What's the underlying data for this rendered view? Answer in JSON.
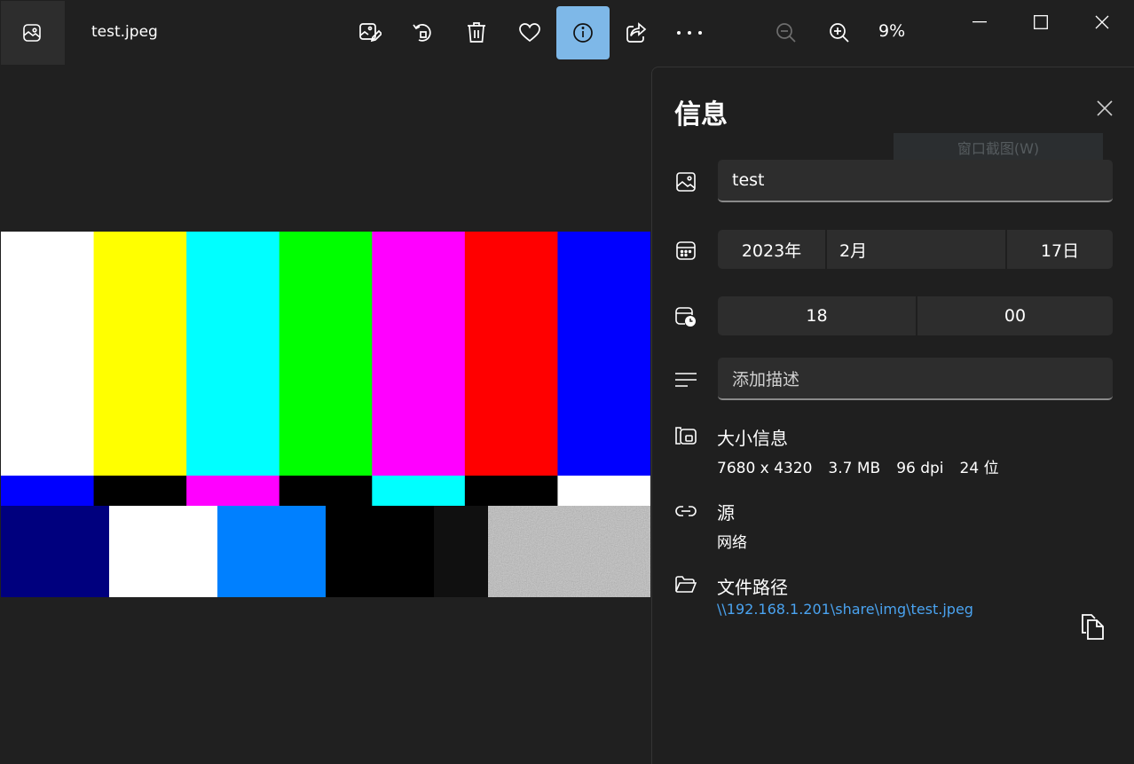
{
  "titlebar": {
    "filename": "test.jpeg",
    "zoom": "9%",
    "toolbar_icons": [
      "edit-image-icon",
      "rotate-icon",
      "delete-icon",
      "favorite-icon",
      "info-icon",
      "share-icon",
      "more-icon",
      "zoom-out-icon",
      "zoom-in-icon"
    ]
  },
  "image": {
    "top_bar_colors": [
      "#ffffff",
      "#ffff00",
      "#00ffff",
      "#00ff00",
      "#ff00ff",
      "#ff0000",
      "#0000ff"
    ],
    "middle_bar_colors": [
      "#0000ff",
      "#000000",
      "#ff00ff",
      "#000000",
      "#00ffff",
      "#000000",
      "#ffffff"
    ],
    "bottom_bar_colors": [
      "#00007e",
      "#ffffff",
      "#0080ff",
      "#000000",
      "#101010",
      "#808080"
    ]
  },
  "panel": {
    "title": "信息",
    "ghost_tooltip": "窗口截图(W)",
    "name_value": "test",
    "date": {
      "year": "2023年",
      "month": "2月",
      "day": "17日"
    },
    "time": {
      "hour": "18",
      "minute": "00"
    },
    "description_placeholder": "添加描述",
    "size": {
      "label": "大小信息",
      "dimensions": "7680 x 4320",
      "filesize": "3.7 MB",
      "dpi": "96 dpi",
      "bits": "24 位"
    },
    "source": {
      "label": "源",
      "value": "网络"
    },
    "path": {
      "label": "文件路径",
      "value": "\\\\192.168.1.201\\share\\img\\test.jpeg"
    }
  },
  "colors": {
    "background": "#202020",
    "accent": "#7eb8e8",
    "link": "#4aa3f0"
  }
}
